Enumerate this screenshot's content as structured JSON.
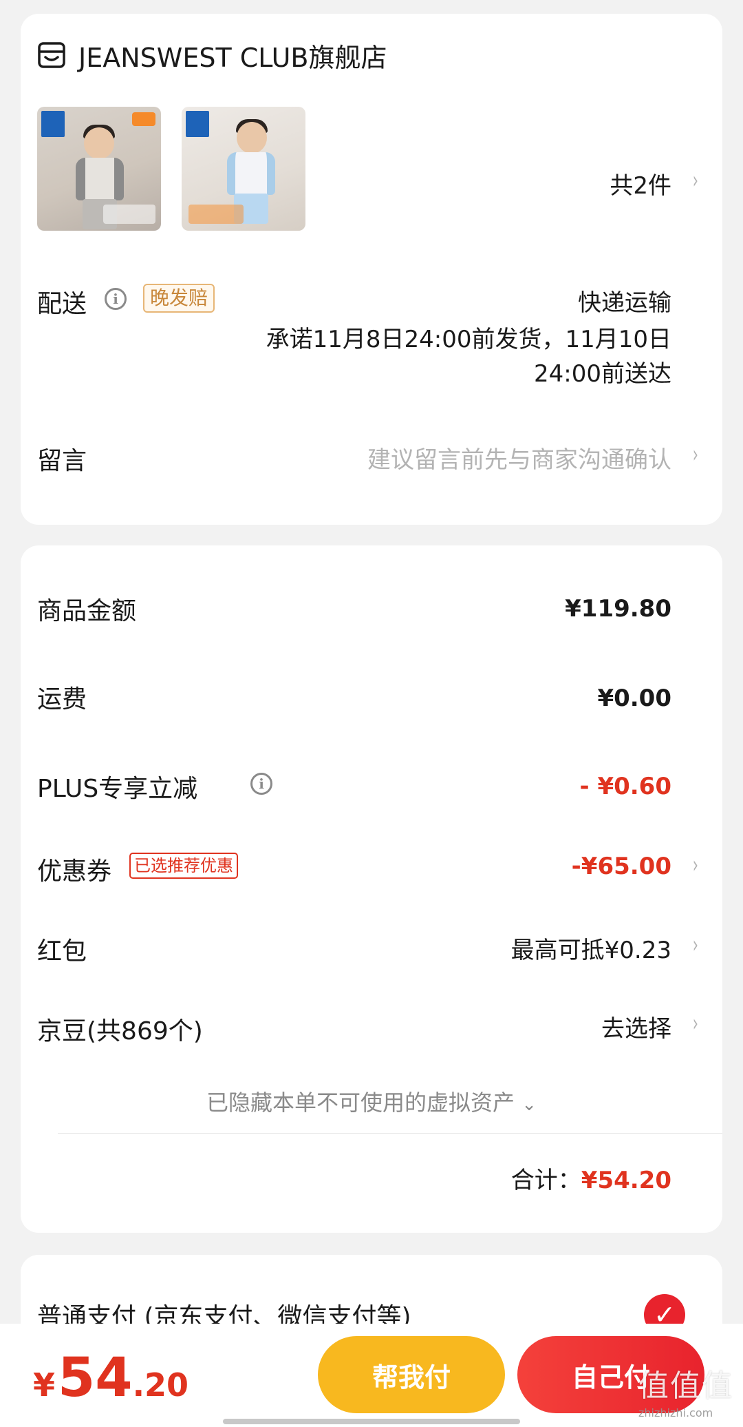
{
  "store": {
    "name": "JEANSWEST CLUB旗舰店",
    "item_count": "共2件",
    "products": [
      {
        "alt": "product-thumbnail-1"
      },
      {
        "alt": "product-thumbnail-2"
      }
    ]
  },
  "delivery": {
    "label": "配送",
    "late_tag": "晚发赔",
    "method": "快递运输",
    "promise": "承诺11月8日24:00前发货，11月10日24:00前送达"
  },
  "message": {
    "label": "留言",
    "placeholder": "建议留言前先与商家沟通确认"
  },
  "price": {
    "goods_label": "商品金额",
    "goods_value": "¥119.80",
    "shipping_label": "运费",
    "shipping_value": "¥0.00",
    "plus_label": "PLUS专享立减",
    "plus_value": "- ¥0.60",
    "coupon_label": "优惠券",
    "coupon_tag": "已选推荐优惠",
    "coupon_value": "-¥65.00",
    "redpack_label": "红包",
    "redpack_value": "最高可抵¥0.23",
    "jingdou_label": "京豆(共869个)",
    "jingdou_value": "去选择",
    "hidden_assets": "已隐藏本单不可使用的虚拟资产",
    "total_label": "合计：",
    "total_value": "¥54.20"
  },
  "payment": {
    "method_label": "普通支付 (京东支付、微信支付等)"
  },
  "bottom": {
    "yen": "¥",
    "total_int": "54",
    "total_dec": ".20",
    "help_pay": "帮我付",
    "self_pay": "自己付"
  },
  "watermark": {
    "glyphs": "值值值",
    "url": "zhizhizhi.com"
  },
  "colors": {
    "accent_red": "#e0331f",
    "pay_yellow": "#f8b81f",
    "tag_gold": "#c8873a"
  }
}
